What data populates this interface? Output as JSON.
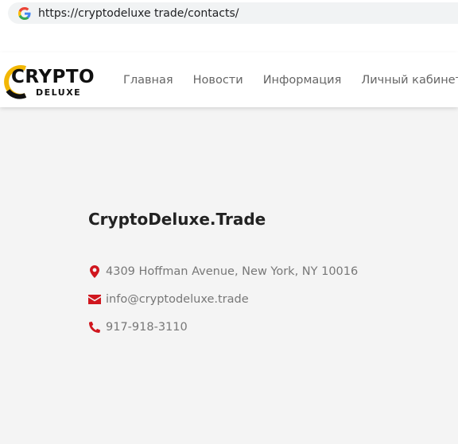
{
  "browser": {
    "url": "https://cryptodeluxe trade/contacts/"
  },
  "logo": {
    "line1": "CRYPTO",
    "line2": "DELUXE"
  },
  "nav": {
    "items": [
      "Главная",
      "Новости",
      "Информация",
      "Личный кабинет"
    ]
  },
  "contacts": {
    "company": "CryptoDeluxe.Trade",
    "address": "4309 Hoffman Avenue, New York, NY 10016",
    "email": "info@cryptodeluxe.trade",
    "phone": "917-918-3110"
  },
  "colors": {
    "accent": "#d0161e",
    "background": "#f4f4f4"
  },
  "icons": {
    "address": "map-marker-icon",
    "email": "envelope-icon",
    "phone": "phone-icon"
  }
}
